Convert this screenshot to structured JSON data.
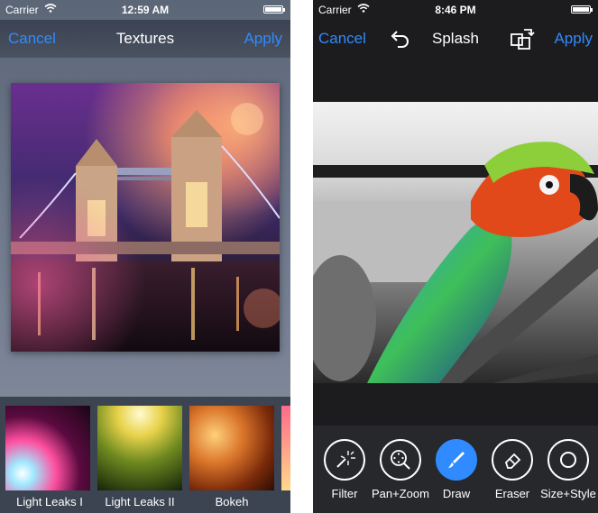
{
  "left_screen": {
    "status_bar": {
      "carrier": "Carrier",
      "time": "12:59 AM",
      "battery_level": 1.0
    },
    "navbar": {
      "cancel_label": "Cancel",
      "title": "Textures",
      "apply_label": "Apply"
    },
    "preview_icon": "tower-bridge-photo",
    "textures": [
      {
        "label": "Light Leaks I",
        "icon": "light-leaks-1-thumbnail"
      },
      {
        "label": "Light Leaks II",
        "icon": "light-leaks-2-thumbnail"
      },
      {
        "label": "Bokeh",
        "icon": "bokeh-thumbnail"
      },
      {
        "label": "",
        "icon": "partial-texture-thumbnail"
      }
    ]
  },
  "right_screen": {
    "status_bar": {
      "carrier": "Carrier",
      "time": "8:46 PM",
      "battery_level": 1.0
    },
    "navbar": {
      "cancel_label": "Cancel",
      "title": "Splash",
      "apply_label": "Apply",
      "undo_icon": "undo-icon",
      "compare_icon": "compare-icon"
    },
    "preview_icon": "parrot-photo",
    "tools": [
      {
        "label": "Filter",
        "icon": "magic-wand-icon",
        "active": false
      },
      {
        "label": "Pan+Zoom",
        "icon": "pan-zoom-icon",
        "active": false
      },
      {
        "label": "Draw",
        "icon": "brush-icon",
        "active": true
      },
      {
        "label": "Eraser",
        "icon": "eraser-icon",
        "active": false
      },
      {
        "label": "Size+Style",
        "icon": "size-style-icon",
        "active": false
      }
    ]
  },
  "colors": {
    "accent": "#2f8bff",
    "toolbar_dark": "#26282c",
    "nav_left": "#3b4353"
  }
}
